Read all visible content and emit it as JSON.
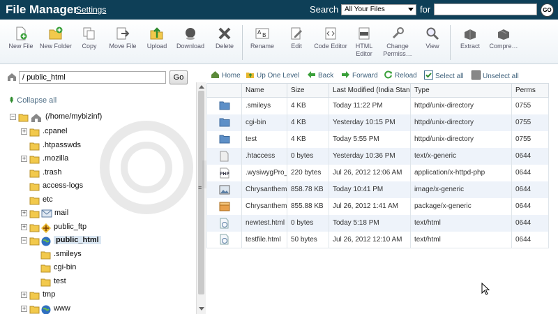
{
  "header": {
    "title": "File Manager",
    "settings_label": "Settings",
    "search_label": "Search",
    "search_scope": "All Your Files",
    "for_label": "for",
    "search_value": "",
    "go_label": "GO"
  },
  "toolbar": {
    "buttons": [
      {
        "label": "New File",
        "icon": "new-file-icon"
      },
      {
        "label": "New Folder",
        "icon": "new-folder-icon"
      },
      {
        "label": "Copy",
        "icon": "copy-icon"
      },
      {
        "label": "Move File",
        "icon": "move-file-icon"
      },
      {
        "label": "Upload",
        "icon": "upload-icon"
      },
      {
        "label": "Download",
        "icon": "download-icon"
      },
      {
        "label": "Delete",
        "icon": "delete-icon"
      },
      {
        "label": "Rename",
        "icon": "rename-icon"
      },
      {
        "label": "Edit",
        "icon": "edit-icon"
      },
      {
        "label": "Code Editor",
        "icon": "code-editor-icon"
      },
      {
        "label": "HTML Editor",
        "icon": "html-editor-icon"
      },
      {
        "label": "Change Permiss…",
        "icon": "permissions-icon"
      },
      {
        "label": "View",
        "icon": "view-icon"
      },
      {
        "label": "Extract",
        "icon": "extract-icon"
      },
      {
        "label": "Compre…",
        "icon": "compress-icon"
      }
    ]
  },
  "path": {
    "value": "public_html",
    "go_label": "Go"
  },
  "nav": {
    "home": "Home",
    "up": "Up One Level",
    "back": "Back",
    "forward": "Forward",
    "reload": "Reload",
    "select_all": "Select all",
    "unselect_all": "Unselect all"
  },
  "tree": {
    "collapse_all": "Collapse all",
    "root": "(/home/mybizinf)",
    "items": [
      {
        "label": ".cpanel"
      },
      {
        "label": ".htpasswds"
      },
      {
        "label": ".mozilla"
      },
      {
        "label": ".trash"
      },
      {
        "label": "access-logs"
      },
      {
        "label": "etc"
      },
      {
        "label": "mail"
      },
      {
        "label": "public_ftp"
      },
      {
        "label": "public_html"
      },
      {
        "label": ".smileys"
      },
      {
        "label": "cgi-bin"
      },
      {
        "label": "test"
      },
      {
        "label": "tmp"
      },
      {
        "label": "www"
      }
    ]
  },
  "table": {
    "columns": [
      "",
      "Name",
      "Size",
      "Last Modified (India Standard Time)",
      "Type",
      "Perms"
    ],
    "rows": [
      {
        "icon": "folder-icon",
        "name": ".smileys",
        "size": "4 KB",
        "modified": "Today 11:22 PM",
        "type": "httpd/unix-directory",
        "perms": "0755"
      },
      {
        "icon": "folder-icon",
        "name": "cgi-bin",
        "size": "4 KB",
        "modified": "Yesterday 10:15 PM",
        "type": "httpd/unix-directory",
        "perms": "0755"
      },
      {
        "icon": "folder-icon",
        "name": "test",
        "size": "4 KB",
        "modified": "Today 5:55 PM",
        "type": "httpd/unix-directory",
        "perms": "0755"
      },
      {
        "icon": "generic-file-icon",
        "name": ".htaccess",
        "size": "0 bytes",
        "modified": "Yesterday 10:36 PM",
        "type": "text/x-generic",
        "perms": "0644"
      },
      {
        "icon": "php-file-icon",
        "name": ".wysiwygPro_edit_",
        "size": "220 bytes",
        "modified": "Jul 26, 2012 12:06 AM",
        "type": "application/x-httpd-php",
        "perms": "0644"
      },
      {
        "icon": "image-file-icon",
        "name": "Chrysanthemum.jpg",
        "size": "858.78 KB",
        "modified": "Today 10:41 PM",
        "type": "image/x-generic",
        "perms": "0644"
      },
      {
        "icon": "package-file-icon",
        "name": "Chrysanthemum.zip",
        "size": "855.88 KB",
        "modified": "Jul 26, 2012 1:41 AM",
        "type": "package/x-generic",
        "perms": "0644"
      },
      {
        "icon": "html-file-icon",
        "name": "newtest.html",
        "size": "0 bytes",
        "modified": "Today 5:18 PM",
        "type": "text/html",
        "perms": "0644"
      },
      {
        "icon": "html-file-icon",
        "name": "testfile.html",
        "size": "50 bytes",
        "modified": "Jul 26, 2012 12:10 AM",
        "type": "text/html",
        "perms": "0644"
      }
    ]
  },
  "colors": {
    "header_bg": "#0e3f57",
    "row_alt": "#eef3fa",
    "link": "#3c5f7a"
  }
}
